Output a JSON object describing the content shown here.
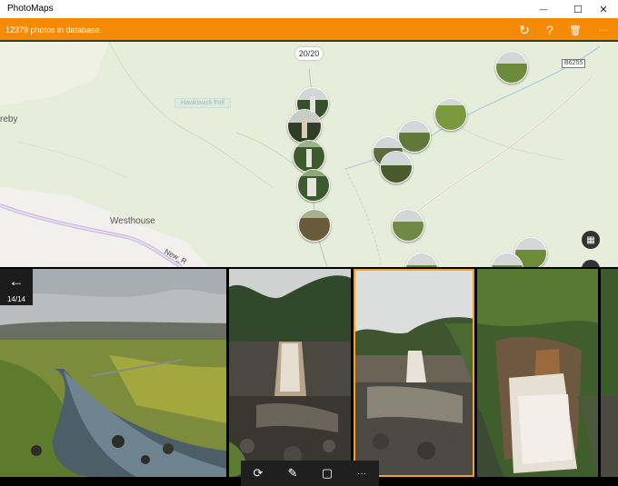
{
  "window": {
    "title": "PhotoMaps",
    "minimize_glyph": "—",
    "maximize_glyph": "☐",
    "close_glyph": "✕"
  },
  "appbar": {
    "status": "12379 photos in database.",
    "refresh_glyph": "↻",
    "help_glyph": "?",
    "delete_glyph": "🗑",
    "more_glyph": "···",
    "accent": "#f58a07"
  },
  "map": {
    "counter": "20/20",
    "road_sign": "B6255",
    "places": [
      "Westhouse",
      "reby"
    ],
    "area_label": "Hawkswick Fell",
    "road_label": "New_R",
    "layers_glyph": "▦"
  },
  "strip": {
    "back_glyph": "←",
    "position": "14/14"
  },
  "toolbar": {
    "rotate_glyph": "⟳",
    "edit_glyph": "✎",
    "note_glyph": "▢",
    "more_glyph": "···"
  }
}
